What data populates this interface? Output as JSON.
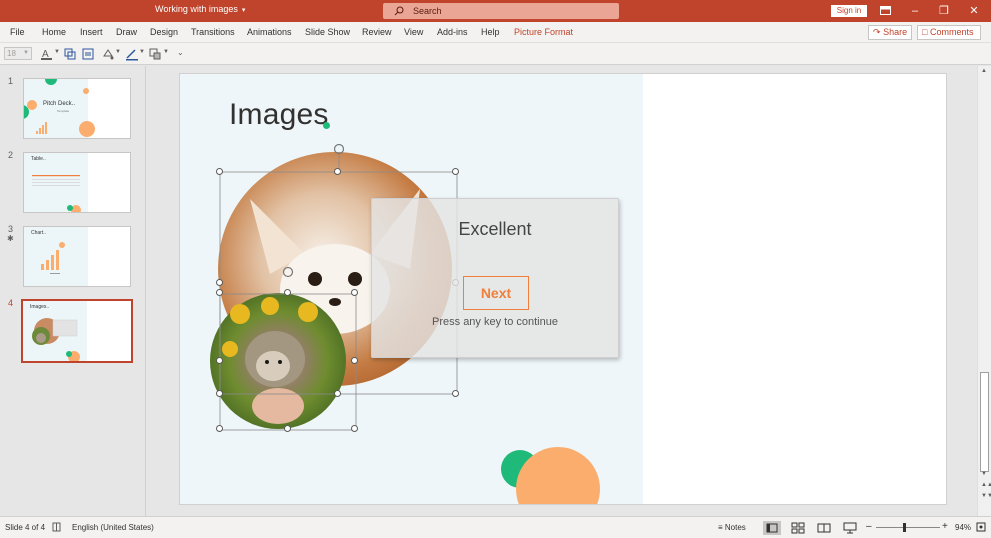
{
  "titlebar": {
    "doc_title": "Working with images",
    "search_placeholder": "Search",
    "signin": "Sign in"
  },
  "menu": {
    "items": [
      "File",
      "Home",
      "Insert",
      "Draw",
      "Design",
      "Transitions",
      "Animations",
      "Slide Show",
      "Review",
      "View",
      "Add-ins",
      "Help",
      "Picture Format"
    ],
    "share": "Share",
    "comments": "Comments"
  },
  "toolbar": {
    "font_size": "18"
  },
  "thumbnails": [
    {
      "num": "1",
      "title": "Pitch Deck..",
      "subtitle": "Template"
    },
    {
      "num": "2",
      "title": "Table.."
    },
    {
      "num": "3",
      "title": "Chart.."
    },
    {
      "num": "4",
      "title": "Images..",
      "selected": true
    }
  ],
  "slide": {
    "title": "Images"
  },
  "popup": {
    "title": "Excellent",
    "button": "Next",
    "hint": "Press any key to continue"
  },
  "status": {
    "slide_info": "Slide 4 of 4",
    "language": "English (United States)",
    "notes": "Notes",
    "zoom": "94%"
  },
  "colors": {
    "accent": "#c0432b",
    "orange": "#ef7f3a",
    "green": "#1fb97a",
    "peach": "#fbad6e"
  }
}
